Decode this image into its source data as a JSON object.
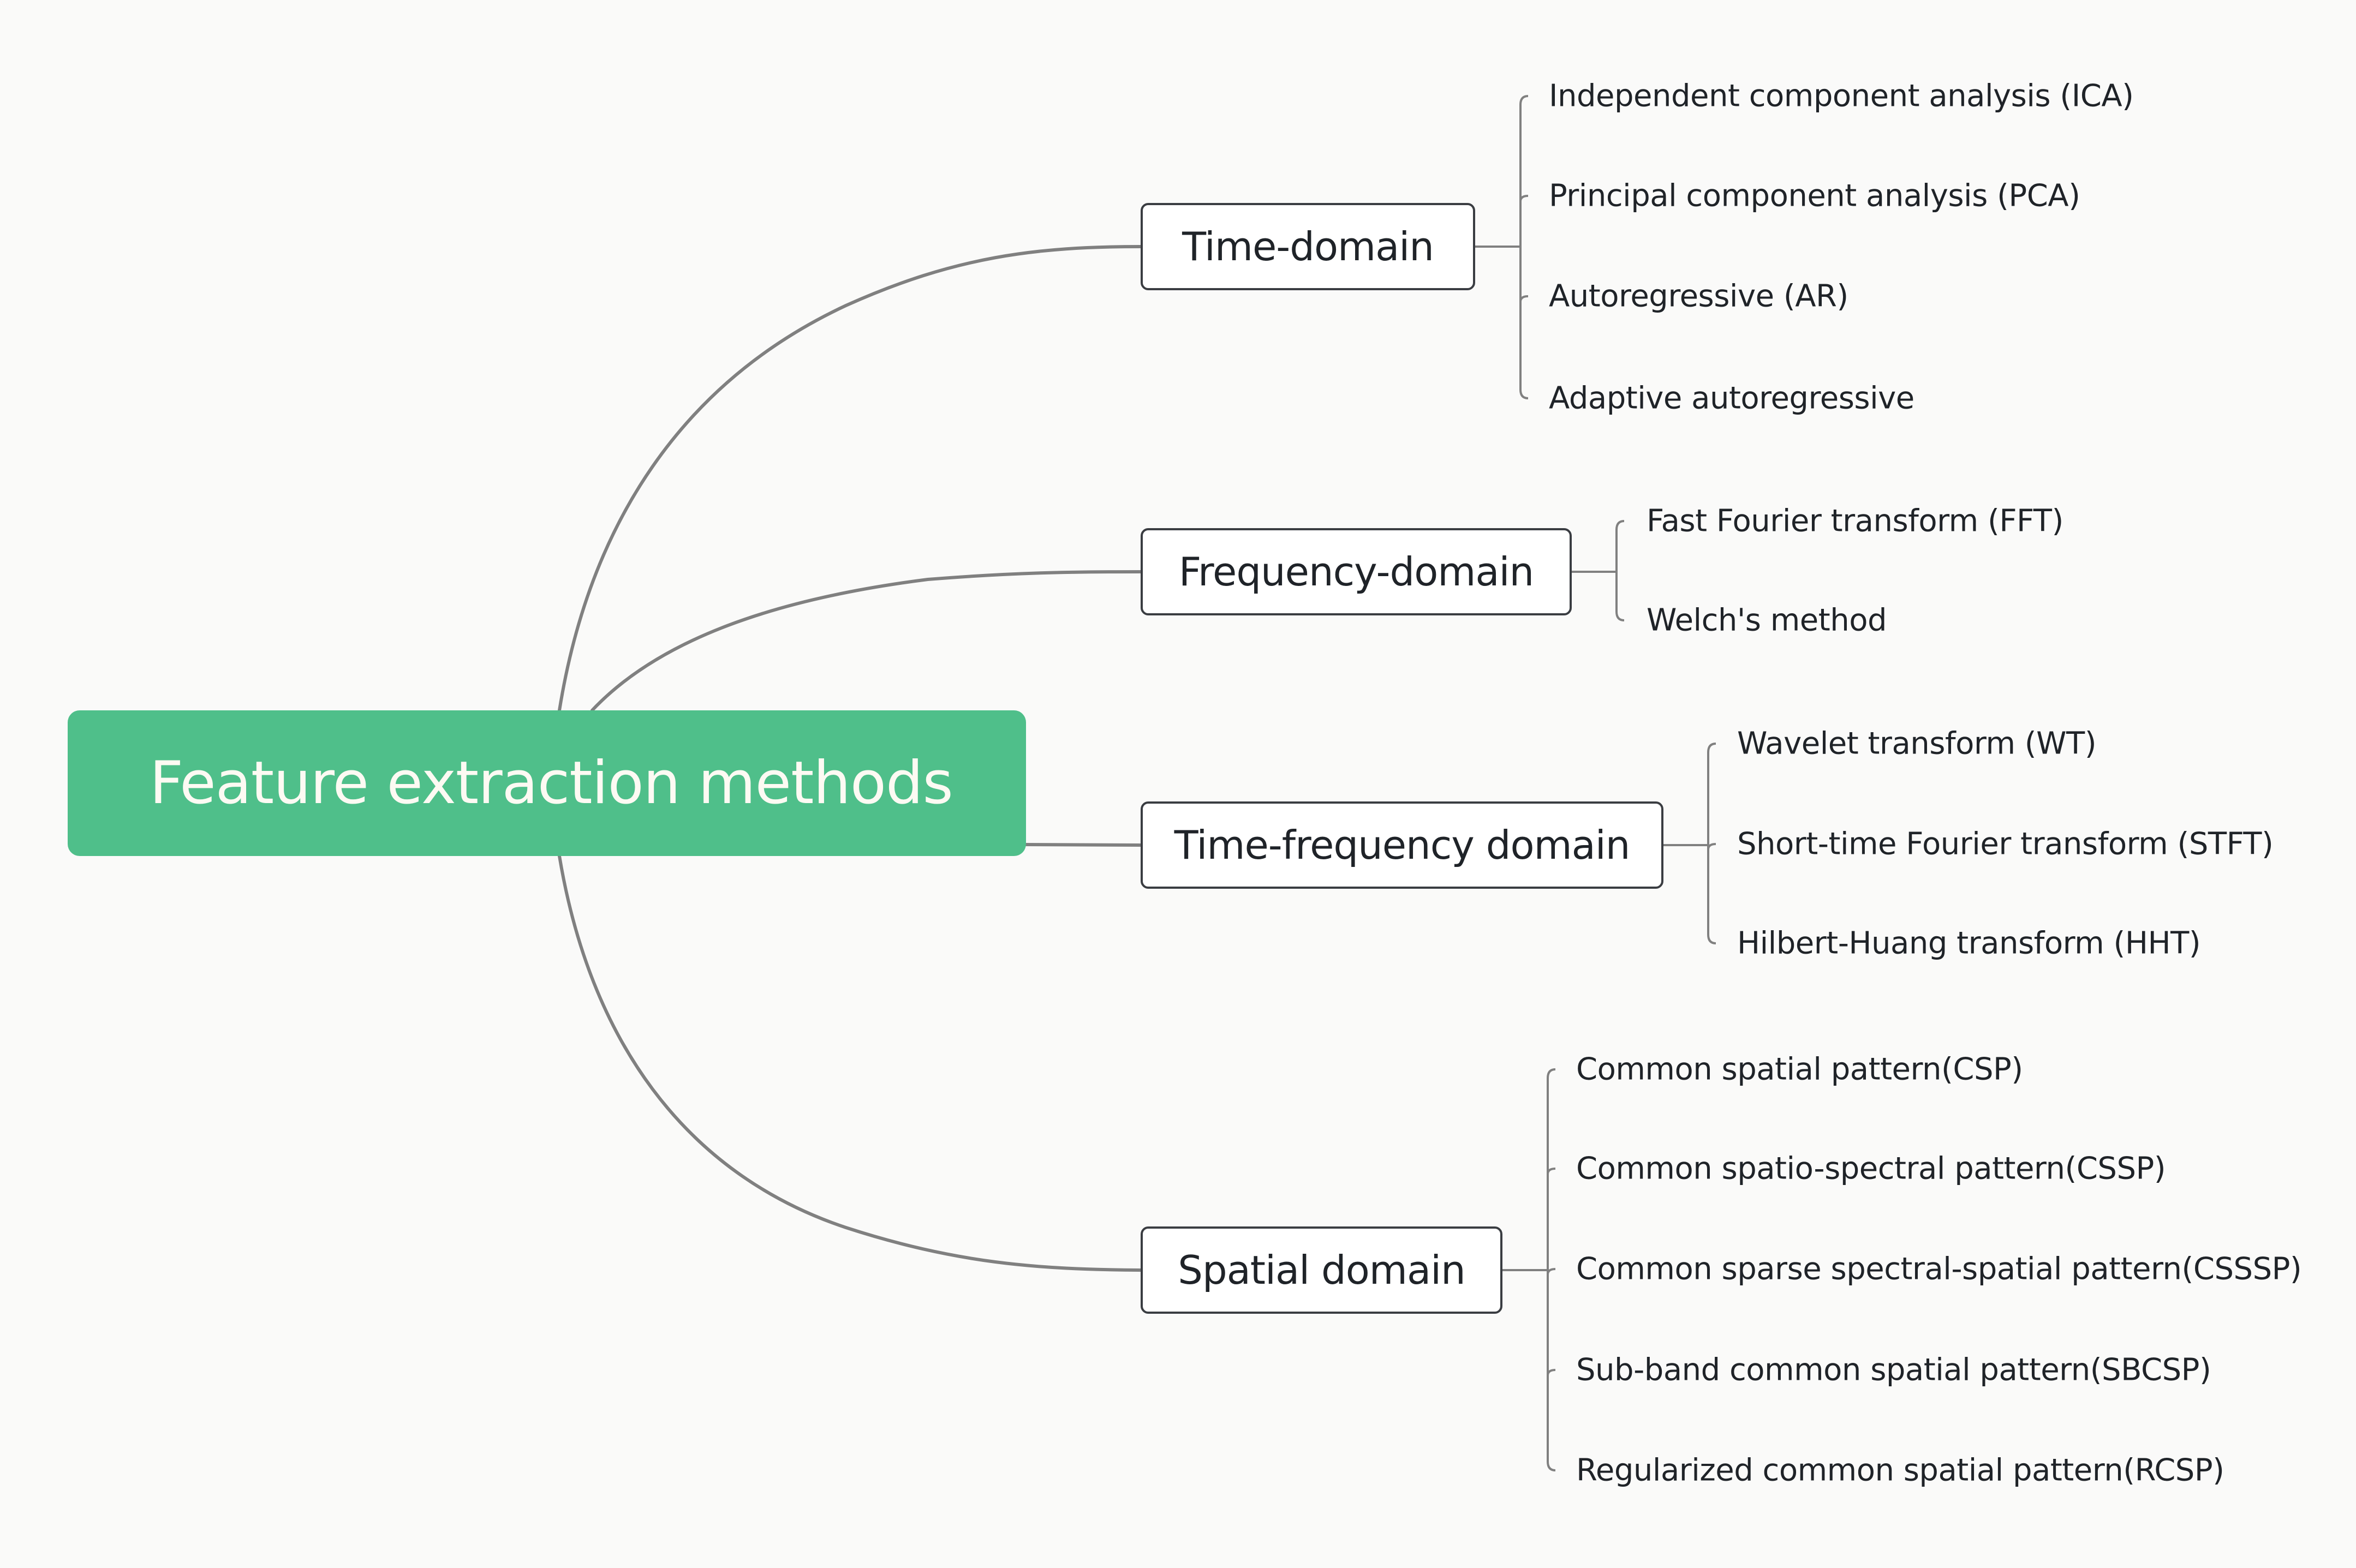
{
  "root": {
    "label": "Feature extraction methods",
    "color": "#4fbf8a"
  },
  "branches": [
    {
      "label": "Time-domain",
      "children": [
        "Independent component analysis (ICA)",
        "Principal component analysis (PCA)",
        "Autoregressive (AR)",
        "Adaptive autoregressive"
      ]
    },
    {
      "label": "Frequency-domain",
      "children": [
        "Fast Fourier transform (FFT)",
        "Welch's method"
      ]
    },
    {
      "label": "Time-frequency domain",
      "children": [
        "Wavelet transform (WT)",
        "Short-time Fourier transform (STFT)",
        "Hilbert-Huang transform (HHT)"
      ]
    },
    {
      "label": "Spatial domain",
      "children": [
        "Common spatial pattern(CSP)",
        "Common spatio-spectral pattern(CSSP)",
        "Common sparse spectral-spatial pattern(CSSSP)",
        "Sub-band common spatial pattern(SBCSP)",
        "Regularized common spatial pattern(RCSP)"
      ]
    }
  ]
}
